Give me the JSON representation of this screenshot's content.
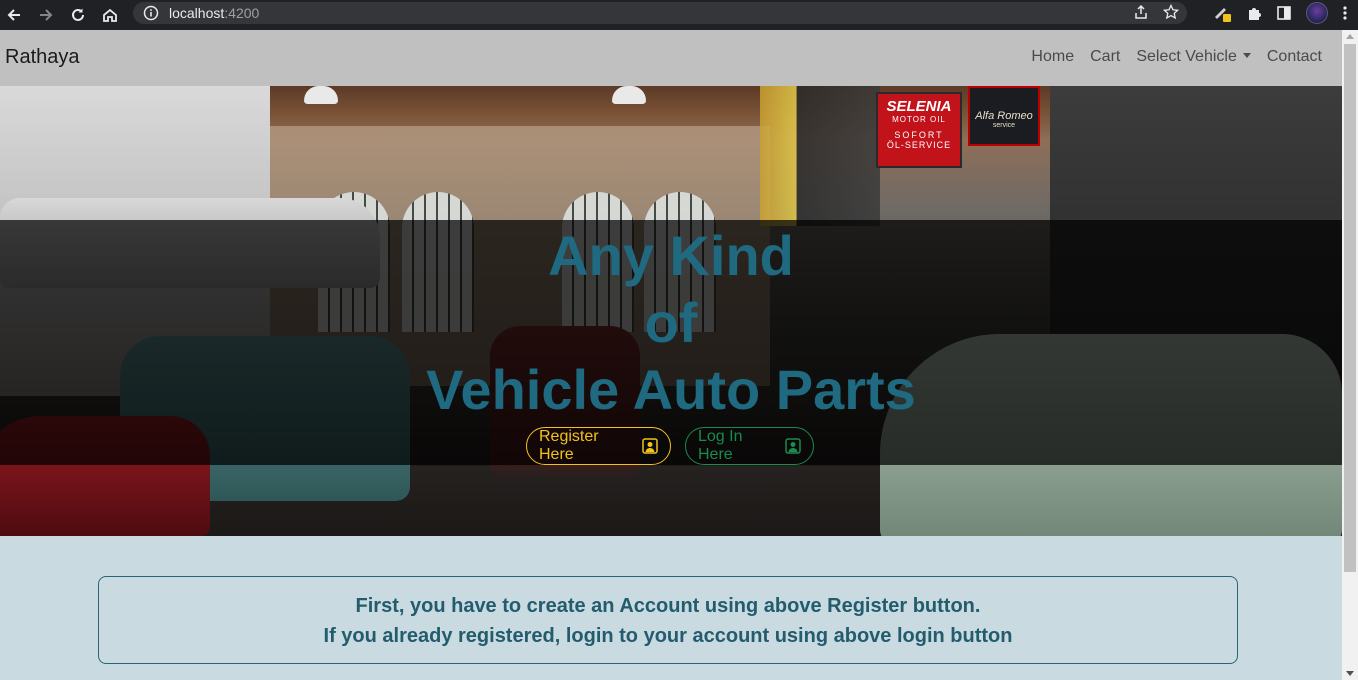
{
  "browser": {
    "url_host": "localhost",
    "url_port": ":4200"
  },
  "navbar": {
    "brand": "Rathaya",
    "links": [
      {
        "label": "Home"
      },
      {
        "label": "Cart"
      },
      {
        "label": "Select Vehicle"
      },
      {
        "label": "Contact"
      }
    ]
  },
  "hero": {
    "title_line1": "Any Kind",
    "title_line2": "of",
    "title_line3": "Vehicle Auto Parts",
    "register_button": "Register Here",
    "login_button": "Log In Here",
    "signs": {
      "selenia": "SELENIA",
      "selenia_sub": "MOTOR OIL",
      "sofort": "SOFORT",
      "oel_service": "ÖL-SERVICE",
      "alfa": "Alfa Romeo",
      "alfa_sub": "service"
    }
  },
  "info": {
    "line1": "First, you have to create an Account using above Register button.",
    "line2": "If you already registered, login to your account using above login button"
  },
  "colors": {
    "navbar_bg": "#c0c0c0",
    "page_bg": "#c9dae1",
    "hero_title": "#1f6a80",
    "register_accent": "#f2c21d",
    "login_accent": "#1a8a4e",
    "info_text": "#235c6d"
  },
  "icons": {
    "back": "arrow-left-icon",
    "forward": "arrow-right-icon",
    "reload": "reload-icon",
    "home": "home-icon",
    "info": "info-icon",
    "share": "share-icon",
    "star": "star-icon",
    "extension": "puzzle-icon",
    "sidepanel": "sidepanel-icon",
    "menu": "kebab-menu-icon",
    "person": "person-badge-icon"
  }
}
